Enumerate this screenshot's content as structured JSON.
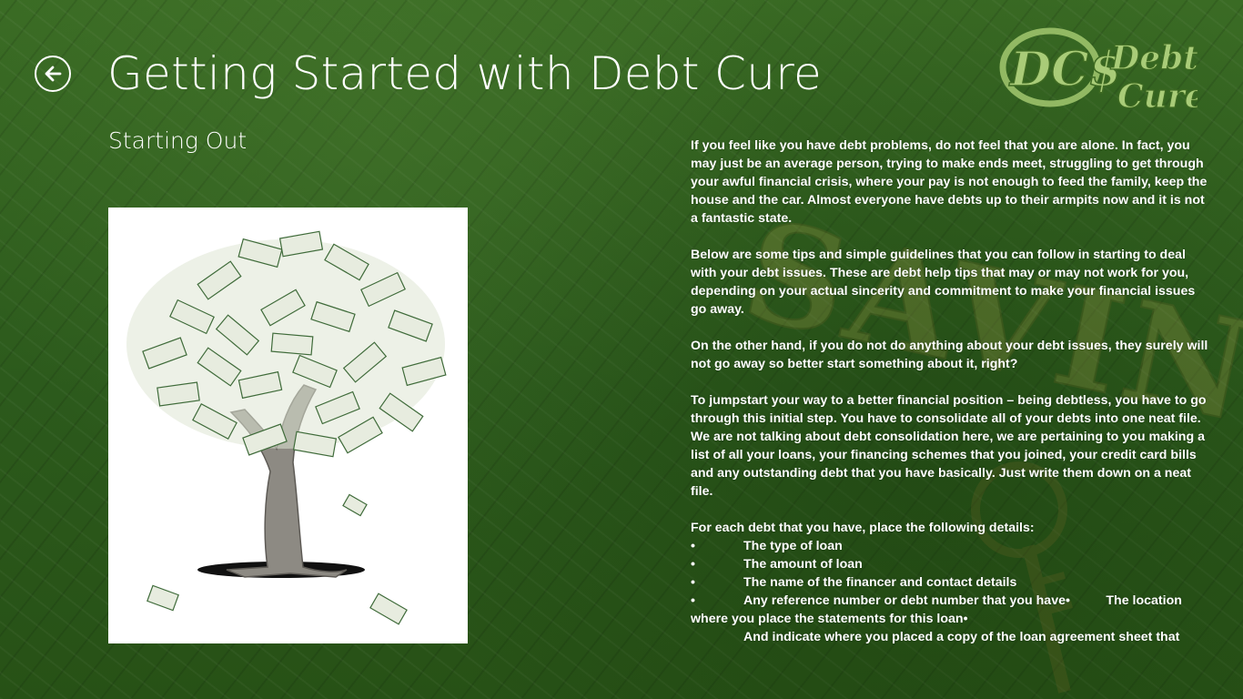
{
  "header": {
    "title": "Getting Started with Debt Cure",
    "back_icon": "back-arrow-icon"
  },
  "section": {
    "title": "Starting Out"
  },
  "image": {
    "subject": "money-tree-image"
  },
  "logo": {
    "monogram": "DC$",
    "word1": "Debt",
    "word2": "Cure"
  },
  "decoration": {
    "word": "SAVINGS"
  },
  "article": {
    "paragraphs": [
      "If you feel like you have debt problems, do not feel that you are alone. In fact, you may just be an average person, trying to make ends meet, struggling to get through your awful financial crisis, where your pay is not enough to feed the family, keep the house and the car. Almost everyone have debts up to their armpits now and it is not a fantastic state.",
      "Below are some tips and simple guidelines that you can follow in starting to deal with your debt issues. These are debt help tips that may or may not work for you, depending on your actual sincerity and commitment to make your financial issues go away.",
      "On the other hand, if you do not do anything about your debt issues, they surely will not go away so better start something about it, right?",
      "To jumpstart your way to a better financial position – being debtless, you have to go through this initial step. You have to consolidate all of your debts into one neat file. We are not talking about debt consolidation here, we are pertaining to you making a list of all your loans, your financing schemes that you joined, your credit card bills and any outstanding debt that you have basically. Just write them down on a neat file."
    ],
    "list_intro": "For each debt that you have, place the following details:",
    "bullet": "•",
    "list_items": [
      "The type of loan",
      "The amount of loan",
      "The name of the financer and contact details",
      "Any reference number or debt number that you have•          The location where you place the statements for this loan•",
      "And indicate where you placed a copy of the loan agreement sheet that"
    ]
  },
  "colors": {
    "background": "#2f5e1f",
    "text": "#ffffff",
    "logo": "#9cc26a"
  }
}
